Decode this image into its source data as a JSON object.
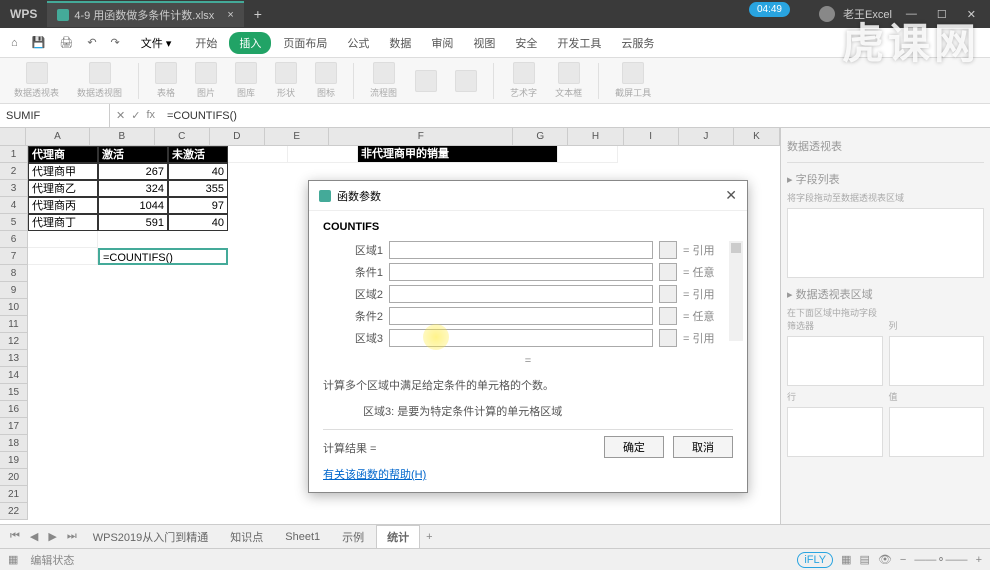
{
  "title": {
    "wps": "WPS",
    "filename": "4-9 用函数做多条件计数.xlsx",
    "user": "老王Excel",
    "timer": "04:49"
  },
  "menu": {
    "file": "文件",
    "items": [
      "开始",
      "插入",
      "页面布局",
      "公式",
      "数据",
      "审阅",
      "视图",
      "安全",
      "开发工具",
      "云服务"
    ],
    "activeIndex": 1
  },
  "ribbon": {
    "labels": [
      "数据透视表",
      "数据透视图",
      "表格",
      "图片",
      "图库",
      "形状",
      "图标",
      "流程图",
      "",
      "",
      "",
      "艺术字",
      "文本框",
      "",
      "截屏工具"
    ]
  },
  "formula": {
    "name": "SUMIF",
    "fx": "fx",
    "value": "=COUNTIFS()"
  },
  "cols": [
    "A",
    "B",
    "C",
    "D",
    "E",
    "F",
    "G",
    "H",
    "I",
    "J",
    "K"
  ],
  "table": {
    "headers": [
      "代理商",
      "激活",
      "未激活"
    ],
    "rows": [
      {
        "a": "代理商甲",
        "b": "267",
        "c": "40"
      },
      {
        "a": "代理商乙",
        "b": "324",
        "c": "355"
      },
      {
        "a": "代理商丙",
        "b": "1044",
        "c": "97"
      },
      {
        "a": "代理商丁",
        "b": "591",
        "c": "40"
      }
    ],
    "title2": "非代理商甲的销量",
    "formula_cell": "=COUNTIFS()"
  },
  "dialog": {
    "title": "函数参数",
    "fname": "COUNTIFS",
    "params": [
      {
        "label": "区域1",
        "hint": "= 引用"
      },
      {
        "label": "条件1",
        "hint": "= 任意"
      },
      {
        "label": "区域2",
        "hint": "= 引用"
      },
      {
        "label": "条件2",
        "hint": "= 任意"
      },
      {
        "label": "区域3",
        "hint": "= 引用"
      }
    ],
    "eq": "=",
    "desc": "计算多个区域中满足给定条件的单元格的个数。",
    "arg_label": "区域3:",
    "arg_desc": "是要为特定条件计算的单元格区域",
    "result_label": "计算结果 =",
    "help": "有关该函数的帮助(H)",
    "ok": "确定",
    "cancel": "取消"
  },
  "sheets": {
    "items": [
      "WPS2019从入门到精通",
      "知识点",
      "Sheet1",
      "示例",
      "统计"
    ],
    "activeIndex": 4
  },
  "status": {
    "text": "编辑状态"
  },
  "side": {
    "t1": "数据透视表",
    "t2": "字段列表",
    "t3": "将字段拖动至数据透视表区域",
    "t4": "数据透视表区域",
    "t5": "在下面区域中拖动字段",
    "f1": "筛选器",
    "f2": "列",
    "f3": "行",
    "f4": "值"
  },
  "watermark": "虎课网"
}
